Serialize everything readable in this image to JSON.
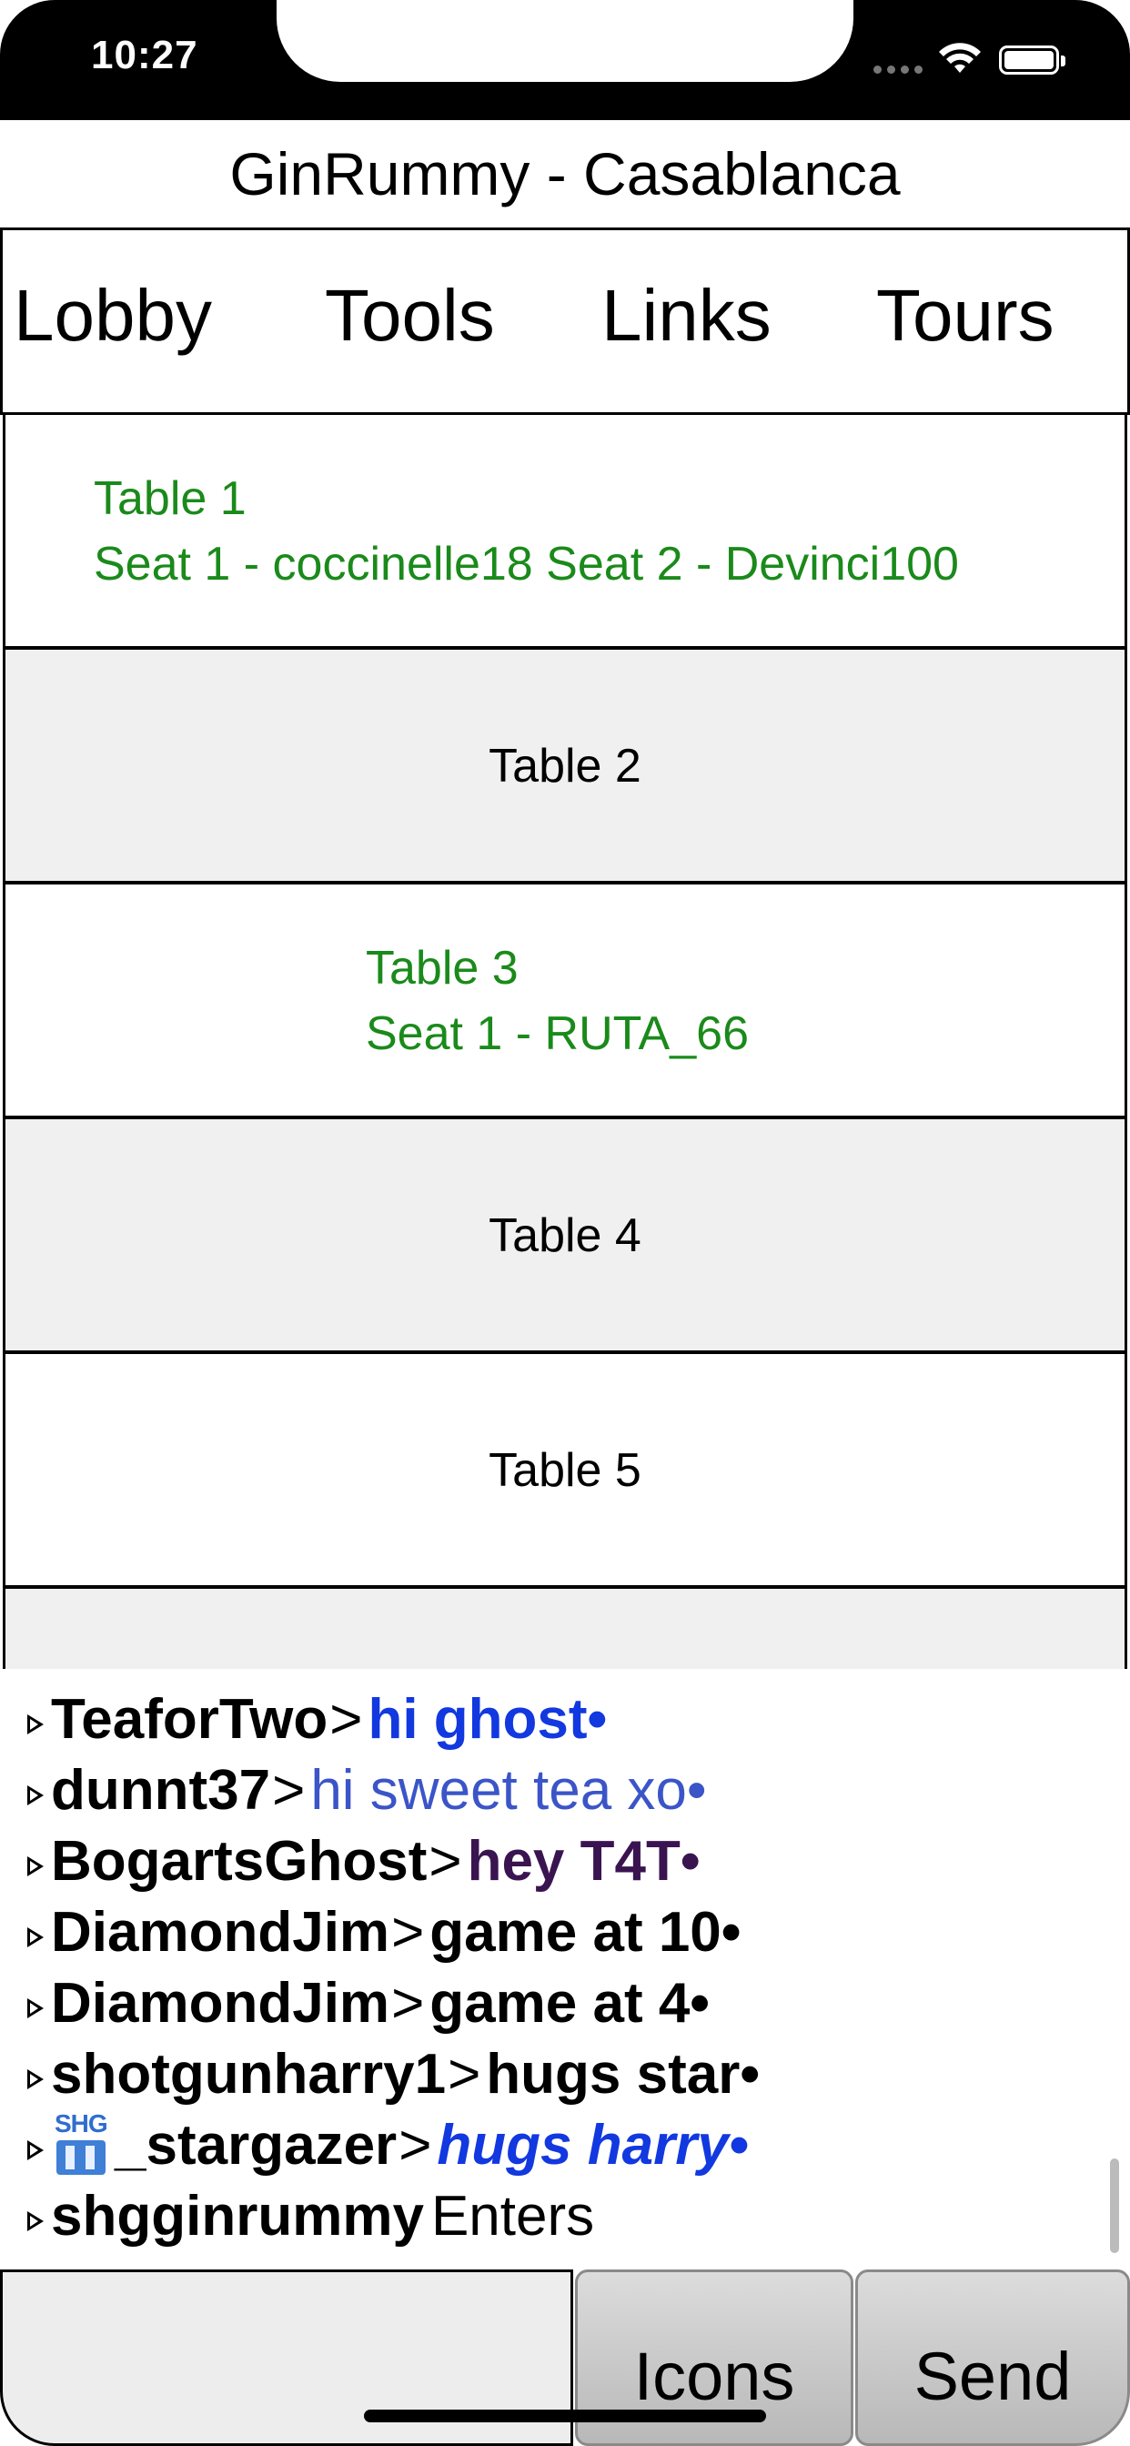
{
  "status_bar": {
    "time": "10:27"
  },
  "room_title": "GinRummy - Casablanca",
  "nav": {
    "tabs": [
      "Lobby",
      "Tools",
      "Links",
      "Tours"
    ]
  },
  "tables": [
    {
      "name": "Table 1",
      "seats": "Seat 1 - coccinelle18 Seat 2 - Devinci100"
    },
    {
      "name": "Table 2",
      "seats": ""
    },
    {
      "name": "Table 3",
      "seats": "Seat 1 - RUTA_66"
    },
    {
      "name": "Table 4",
      "seats": ""
    },
    {
      "name": "Table 5",
      "seats": ""
    }
  ],
  "chat": [
    {
      "user": "TeaforTwo",
      "sep": ">",
      "message": "hi ghost•",
      "color": "#1238e0"
    },
    {
      "user": "dunnt37",
      "sep": ">",
      "message": "hi sweet tea xo•",
      "color": "#3b55c8"
    },
    {
      "user": "BogartsGhost",
      "sep": ">",
      "message": "hey T4T•",
      "color": "#3a1450"
    },
    {
      "user": "DiamondJim",
      "sep": ">",
      "message": "game at 10•",
      "color": "#000000"
    },
    {
      "user": "DiamondJim",
      "sep": ">",
      "message": "game at 4•",
      "color": "#000000"
    },
    {
      "user": "shotgunharry1",
      "sep": ">",
      "message": "hugs star•",
      "color": "#000000"
    },
    {
      "badge": "SHG",
      "user": "_stargazer",
      "sep": ">",
      "message": "hugs harry•",
      "color": "#1238e0"
    },
    {
      "user": "shgginrummy",
      "sep": "",
      "message": "Enters",
      "color": "#000000"
    }
  ],
  "input": {
    "placeholder": ""
  },
  "buttons": {
    "icons_label": "Icons",
    "send_label": "Send"
  },
  "colors": {
    "table_green": "#1a8a1a",
    "row_gray": "#f0f0f0"
  }
}
